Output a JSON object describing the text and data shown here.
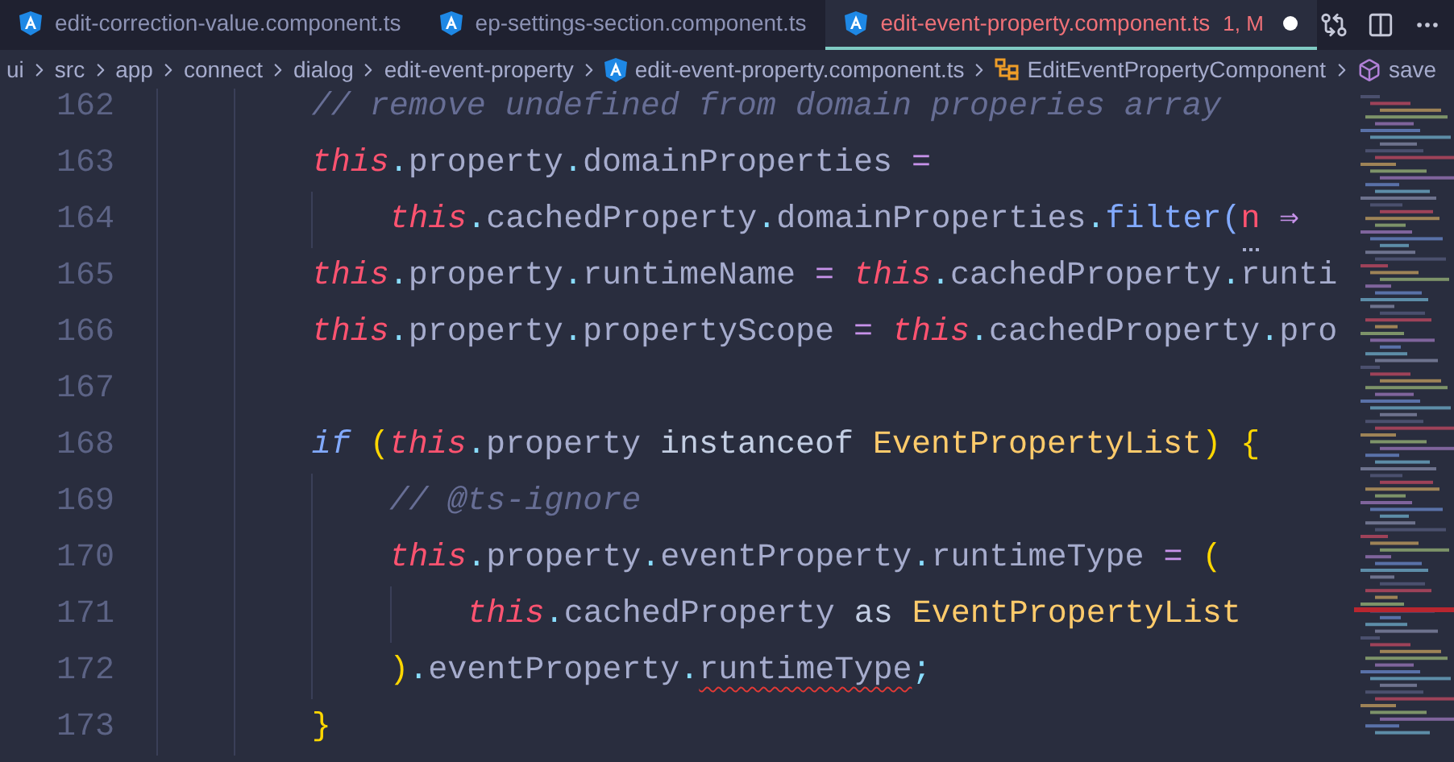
{
  "tabs": [
    {
      "label": "edit-correction-value.component.ts",
      "selected": false,
      "modified": false
    },
    {
      "label": "ep-settings-section.component.ts",
      "selected": false,
      "modified": false
    },
    {
      "label": "edit-event-property.component.ts",
      "selected": true,
      "status": "1, M",
      "modified": true
    }
  ],
  "breadcrumb": [
    {
      "label": "ui",
      "kind": "folder"
    },
    {
      "label": "src",
      "kind": "folder"
    },
    {
      "label": "app",
      "kind": "folder"
    },
    {
      "label": "connect",
      "kind": "folder"
    },
    {
      "label": "dialog",
      "kind": "folder"
    },
    {
      "label": "edit-event-property",
      "kind": "folder"
    },
    {
      "label": "edit-event-property.component.ts",
      "kind": "file"
    },
    {
      "label": "EditEventPropertyComponent",
      "kind": "class"
    },
    {
      "label": "save",
      "kind": "method"
    }
  ],
  "lines": [
    {
      "number": "162",
      "tokens": [
        {
          "text": "// remove undefined from domain properies array",
          "kind": "comment"
        }
      ]
    },
    {
      "number": "163",
      "tokens": [
        {
          "text": "this",
          "kind": "this"
        },
        {
          "text": ".",
          "kind": "punct"
        },
        {
          "text": "property",
          "kind": "ident"
        },
        {
          "text": ".",
          "kind": "punct"
        },
        {
          "text": "domainProperties",
          "kind": "ident"
        },
        {
          "text": " =",
          "kind": "op"
        }
      ],
      "children": [
        {
          "number": "164",
          "tokens": [
            {
              "text": "this",
              "kind": "this"
            },
            {
              "text": ".",
              "kind": "punct"
            },
            {
              "text": "cachedProperty",
              "kind": "ident"
            },
            {
              "text": ".",
              "kind": "punct"
            },
            {
              "text": "domainProperties",
              "kind": "ident"
            },
            {
              "text": ".",
              "kind": "punct"
            },
            {
              "text": "filter",
              "kind": "func"
            },
            {
              "text": "(",
              "kind": "paren"
            },
            {
              "text": "n",
              "kind": "param",
              "hint": true
            },
            {
              "text": " ⇒",
              "kind": "op"
            }
          ]
        }
      ]
    },
    {
      "number": "165",
      "tokens": [
        {
          "text": "this",
          "kind": "this"
        },
        {
          "text": ".",
          "kind": "punct"
        },
        {
          "text": "property",
          "kind": "ident"
        },
        {
          "text": ".",
          "kind": "punct"
        },
        {
          "text": "runtimeName",
          "kind": "ident"
        },
        {
          "text": " = ",
          "kind": "op"
        },
        {
          "text": "this",
          "kind": "this"
        },
        {
          "text": ".",
          "kind": "punct"
        },
        {
          "text": "cachedProperty",
          "kind": "ident"
        },
        {
          "text": ".",
          "kind": "punct"
        },
        {
          "text": "runti",
          "kind": "ident"
        }
      ]
    },
    {
      "number": "166",
      "tokens": [
        {
          "text": "this",
          "kind": "this"
        },
        {
          "text": ".",
          "kind": "punct"
        },
        {
          "text": "property",
          "kind": "ident"
        },
        {
          "text": ".",
          "kind": "punct"
        },
        {
          "text": "propertyScope",
          "kind": "ident"
        },
        {
          "text": " = ",
          "kind": "op"
        },
        {
          "text": "this",
          "kind": "this"
        },
        {
          "text": ".",
          "kind": "punct"
        },
        {
          "text": "cachedProperty",
          "kind": "ident"
        },
        {
          "text": ".",
          "kind": "punct"
        },
        {
          "text": "pro",
          "kind": "ident"
        }
      ]
    },
    {
      "number": "167"
    },
    {
      "number": "168",
      "tokens": [
        {
          "text": "if ",
          "kind": "keyword"
        },
        {
          "text": "(",
          "kind": "bracket"
        },
        {
          "text": "this",
          "kind": "this"
        },
        {
          "text": ".",
          "kind": "punct"
        },
        {
          "text": "property ",
          "kind": "ident"
        },
        {
          "text": "instanceof ",
          "kind": "operator-word"
        },
        {
          "text": "EventPropertyList",
          "kind": "type"
        },
        {
          "text": ") {",
          "kind": "bracket"
        }
      ],
      "children": [
        {
          "number": "169",
          "tokens": [
            {
              "text": "// @ts-ignore",
              "kind": "comment"
            }
          ]
        },
        {
          "number": "170",
          "tokens": [
            {
              "text": "this",
              "kind": "this"
            },
            {
              "text": ".",
              "kind": "punct"
            },
            {
              "text": "property",
              "kind": "ident"
            },
            {
              "text": ".",
              "kind": "punct"
            },
            {
              "text": "eventProperty",
              "kind": "ident"
            },
            {
              "text": ".",
              "kind": "punct"
            },
            {
              "text": "runtimeType",
              "kind": "ident"
            },
            {
              "text": " = ",
              "kind": "op"
            },
            {
              "text": "(",
              "kind": "bracket"
            }
          ],
          "children": [
            {
              "number": "171",
              "tokens": [
                {
                  "text": "this",
                  "kind": "this"
                },
                {
                  "text": ".",
                  "kind": "punct"
                },
                {
                  "text": "cachedProperty ",
                  "kind": "ident"
                },
                {
                  "text": "as ",
                  "kind": "operator-word"
                },
                {
                  "text": "EventPropertyList",
                  "kind": "type"
                }
              ]
            }
          ]
        },
        {
          "number": "172",
          "tokens": [
            {
              "text": ")",
              "kind": "bracket"
            },
            {
              "text": ".",
              "kind": "punct"
            },
            {
              "text": "eventProperty",
              "kind": "ident"
            },
            {
              "text": ".",
              "kind": "punct"
            },
            {
              "text": "runtimeType",
              "kind": "ident",
              "error": true
            },
            {
              "text": ";",
              "kind": "punct"
            }
          ]
        }
      ]
    },
    {
      "number": "173",
      "tokens": [
        {
          "text": "}",
          "kind": "bracket"
        }
      ]
    }
  ]
}
